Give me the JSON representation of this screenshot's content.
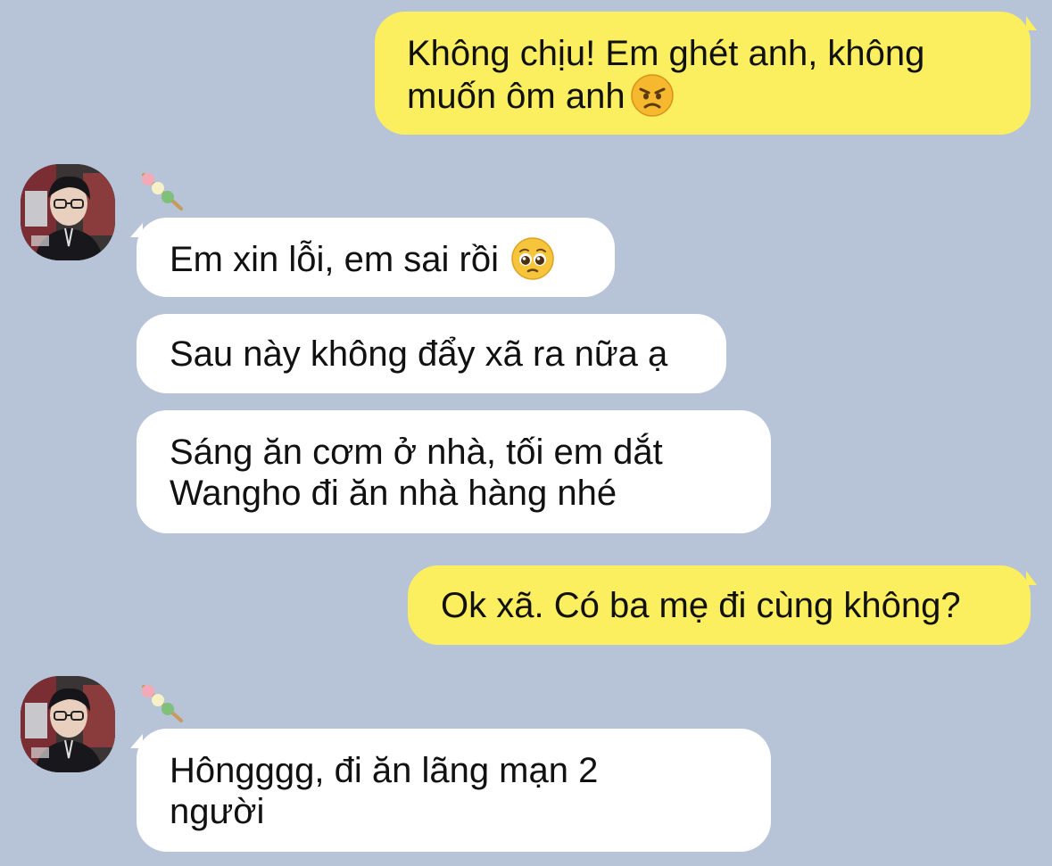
{
  "messages": [
    {
      "id": "m1",
      "direction": "outgoing",
      "lines": [
        "Không chịu! Em ghét anh, không",
        "muốn ôm anh"
      ],
      "emoji": "angry-face"
    },
    {
      "id": "m2",
      "direction": "incoming",
      "lines": [
        "Em xin lỗi, em sai rồi"
      ],
      "emoji": "pleading-face"
    },
    {
      "id": "m3",
      "direction": "incoming",
      "lines": [
        "Sau này không đẩy xã ra nữa ạ"
      ]
    },
    {
      "id": "m4",
      "direction": "incoming",
      "lines": [
        "Sáng ăn cơm ở nhà, tối em dắt",
        "Wangho đi ăn nhà hàng nhé"
      ]
    },
    {
      "id": "m5",
      "direction": "outgoing",
      "lines": [
        "Ok xã. Có ba mẹ đi cùng không?"
      ]
    },
    {
      "id": "m6",
      "direction": "incoming",
      "lines": [
        "Hôngggg, đi ăn lãng mạn 2",
        "người"
      ]
    }
  ],
  "icons": {
    "sender_badge": "dango-icon",
    "avatar": "contact-avatar"
  },
  "colors": {
    "background": "#b7c3d7",
    "outgoing_bubble": "#fbef5f",
    "incoming_bubble": "#ffffff"
  }
}
